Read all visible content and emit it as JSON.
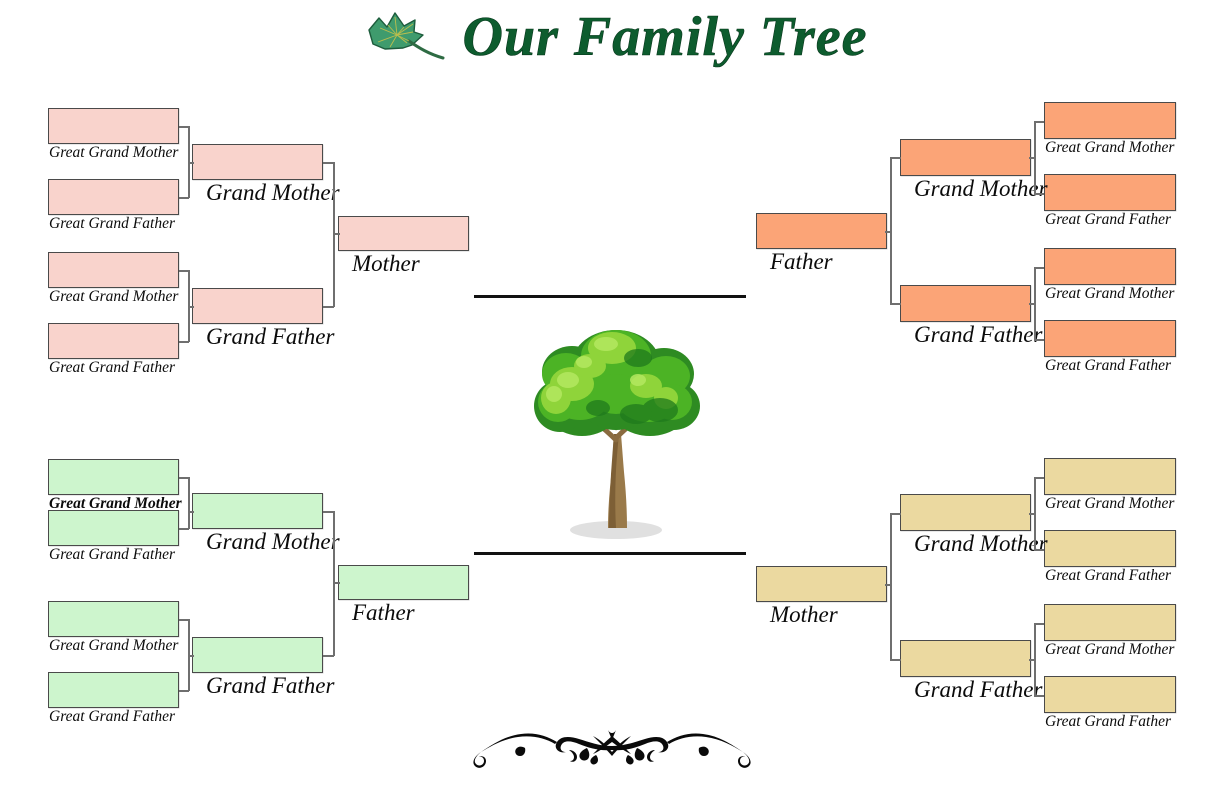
{
  "header": {
    "title": "Our Family Tree",
    "leaf_icon": "leaf-icon"
  },
  "center": {
    "tree_icon": "tree-illustration",
    "ornament_icon": "decorative-flourish-ornament",
    "divider_top": "",
    "divider_bottom": ""
  },
  "colors": {
    "maternal_pink": "#f9d3cc",
    "paternal_green": "#cdf5cd",
    "paternal_orange": "#fba477",
    "maternal_tan": "#ebd9a0",
    "title_green": "#0d5c2e",
    "box_border": "#4a4a4a",
    "connector": "#6f6f6f"
  },
  "quadrants": {
    "top_left": {
      "name": "mother-maternal-branch",
      "color": "#f9d3cc",
      "root": {
        "label": "Mother"
      },
      "grandparents": [
        {
          "label": "Grand Mother"
        },
        {
          "label": "Grand Father"
        }
      ],
      "great_grandparents": [
        {
          "label": "Great Grand Mother"
        },
        {
          "label": "Great Grand Father"
        },
        {
          "label": "Great Grand Mother"
        },
        {
          "label": "Great Grand Father"
        }
      ]
    },
    "bottom_left": {
      "name": "father-paternal-branch",
      "color": "#cdf5cd",
      "root": {
        "label": "Father"
      },
      "grandparents": [
        {
          "label": "Grand Mother"
        },
        {
          "label": "Grand Father"
        }
      ],
      "great_grandparents": [
        {
          "label": "Great Grand Mother"
        },
        {
          "label": "Great Grand Father"
        },
        {
          "label": "Great Grand Mother"
        },
        {
          "label": "Great Grand Father"
        }
      ]
    },
    "top_right": {
      "name": "father-branch",
      "color": "#fba477",
      "root": {
        "label": "Father"
      },
      "grandparents": [
        {
          "label": "Grand Mother"
        },
        {
          "label": "Grand Father"
        }
      ],
      "great_grandparents": [
        {
          "label": "Great Grand Mother"
        },
        {
          "label": "Great Grand Father"
        },
        {
          "label": "Great Grand Mother"
        },
        {
          "label": "Great Grand Father"
        }
      ]
    },
    "bottom_right": {
      "name": "mother-branch",
      "color": "#ebd9a0",
      "root": {
        "label": "Mother"
      },
      "grandparents": [
        {
          "label": "Grand Mother"
        },
        {
          "label": "Grand Father"
        }
      ],
      "great_grandparents": [
        {
          "label": "Great Grand Mother"
        },
        {
          "label": "Great Grand Father"
        },
        {
          "label": "Great Grand Mother"
        },
        {
          "label": "Great Grand Father"
        }
      ]
    }
  }
}
